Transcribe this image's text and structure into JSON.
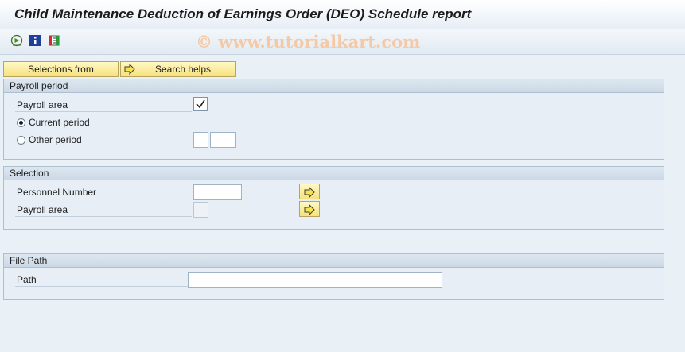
{
  "title": "Child Maintenance Deduction of Earnings Order (DEO) Schedule report",
  "watermark": "© www.tutorialkart.com",
  "toolbar": {
    "icons": [
      "execute-icon",
      "info-icon",
      "selection-variant-icon"
    ]
  },
  "buttons": {
    "selections_from": "Selections from",
    "search_helps": "Search helps"
  },
  "payroll_period": {
    "header": "Payroll period",
    "payroll_area_label": "Payroll area",
    "payroll_area_checked": true,
    "current_period_label": "Current period",
    "other_period_label": "Other period",
    "selected_option": "current"
  },
  "selection": {
    "header": "Selection",
    "personnel_number_label": "Personnel Number",
    "personnel_number_value": "",
    "payroll_area_label": "Payroll area",
    "payroll_area_value": ""
  },
  "file_path": {
    "header": "File Path",
    "path_label": "Path",
    "path_value": ""
  },
  "colors": {
    "background": "#e9f0f6",
    "button": "#f6e27e",
    "group_border": "#aebfd0"
  }
}
